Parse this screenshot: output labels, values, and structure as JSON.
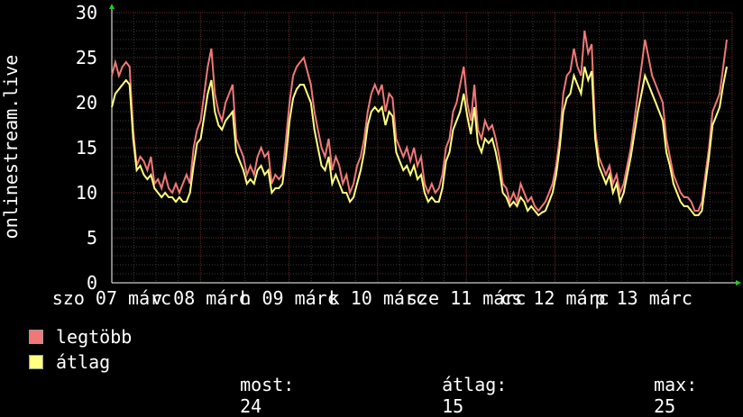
{
  "chart_data": {
    "type": "line",
    "ylabel": "onlinestream.live",
    "ylim": [
      0,
      30
    ],
    "yticks": [
      0,
      5,
      10,
      15,
      20,
      25,
      30
    ],
    "x_tick_labels": [
      "szo 07 márc",
      "v 08 márc",
      "h 09 márc",
      "k 10 márc",
      "sze 11 márc",
      "cs 12 márc",
      "p 13 márc"
    ],
    "grid": true,
    "series": [
      {
        "name": "legtöbb",
        "color": "#f07878",
        "values": [
          23,
          24.5,
          23,
          24,
          24.5,
          24,
          17,
          13,
          14,
          13.5,
          12.5,
          14,
          11,
          11.5,
          10.5,
          12,
          10.5,
          10,
          11,
          10,
          11,
          12,
          11,
          15,
          17,
          18,
          21,
          24,
          26,
          21,
          19,
          18,
          20,
          21,
          22,
          16,
          15,
          14,
          12,
          13,
          12,
          14,
          15,
          14,
          14.5,
          11,
          12,
          11.5,
          12,
          16,
          20,
          23,
          24,
          24.5,
          25,
          23.5,
          22,
          19,
          17,
          15,
          14,
          16,
          12.5,
          14,
          13,
          11,
          12,
          10,
          11,
          13,
          14,
          16,
          19,
          21,
          22,
          21,
          22,
          19,
          21,
          20.5,
          16,
          15,
          14,
          15,
          13.5,
          15,
          13,
          14,
          11,
          10,
          11,
          10,
          10.5,
          12,
          15,
          16,
          19,
          20,
          22,
          24,
          20,
          18,
          22,
          17,
          16,
          18,
          17,
          17.5,
          16,
          14,
          11,
          10.5,
          9,
          10,
          9,
          11,
          10,
          9,
          9.5,
          8.5,
          8,
          8.5,
          9,
          10,
          11,
          13,
          16,
          21,
          23,
          23.5,
          26,
          24,
          23,
          28,
          25.5,
          26.5,
          17,
          14,
          13,
          12,
          13,
          11,
          12,
          10,
          11,
          13,
          15,
          18,
          21,
          24,
          27,
          25,
          23,
          22,
          21,
          20,
          16,
          14,
          12,
          11,
          10,
          9.5,
          9.5,
          9,
          8,
          8,
          9,
          12,
          15,
          19,
          20,
          21,
          24,
          27
        ]
      },
      {
        "name": "átlag",
        "color": "#ffff80",
        "values": [
          19.5,
          21,
          21.5,
          22,
          22.5,
          22,
          16,
          12.5,
          13,
          12,
          11.5,
          12,
          10.5,
          10,
          9.5,
          10,
          9.5,
          9.5,
          9,
          9.5,
          9,
          9,
          10,
          13,
          15.5,
          16,
          18.5,
          21,
          22.5,
          19,
          17.5,
          17,
          18,
          18.5,
          19,
          14.5,
          13.5,
          12.5,
          11,
          11.5,
          11,
          12.5,
          13,
          12,
          12.5,
          10,
          10.5,
          10.5,
          11,
          14,
          18,
          20.5,
          21.5,
          22,
          22,
          21,
          20,
          17,
          15,
          13,
          12.5,
          14,
          11,
          12,
          11,
          10,
          10,
          9,
          9.5,
          11,
          12.5,
          14.5,
          17.5,
          19,
          19.5,
          19,
          19.5,
          17.5,
          19,
          18.5,
          14.5,
          13.5,
          12.5,
          13,
          12,
          13,
          11.5,
          12,
          10,
          9,
          9.5,
          9,
          9,
          10.5,
          13.5,
          14.5,
          17,
          18,
          19,
          21,
          18.5,
          16.5,
          19.5,
          15.5,
          14.5,
          16,
          15.5,
          16,
          14.5,
          12.5,
          10,
          9.5,
          8.5,
          9,
          8.5,
          9.5,
          9,
          8,
          8.5,
          8,
          7.5,
          7.8,
          8,
          9,
          10,
          12,
          15,
          19,
          20.5,
          21,
          23,
          22,
          21,
          24,
          22.5,
          23.5,
          16,
          13,
          12,
          11,
          12,
          10,
          11,
          9,
          10,
          12,
          14,
          16.5,
          19,
          21,
          23,
          22,
          21,
          20,
          19,
          18,
          14.5,
          13,
          11,
          10,
          9,
          8.5,
          8.5,
          8,
          7.5,
          7.5,
          8,
          11,
          14,
          17.5,
          18.5,
          19.5,
          22,
          24
        ]
      }
    ]
  },
  "stats": {
    "most_label": "most:",
    "most_value": "24",
    "avg_label": "átlag:",
    "avg_value": "15",
    "max_label": "max:",
    "max_value": "25"
  }
}
